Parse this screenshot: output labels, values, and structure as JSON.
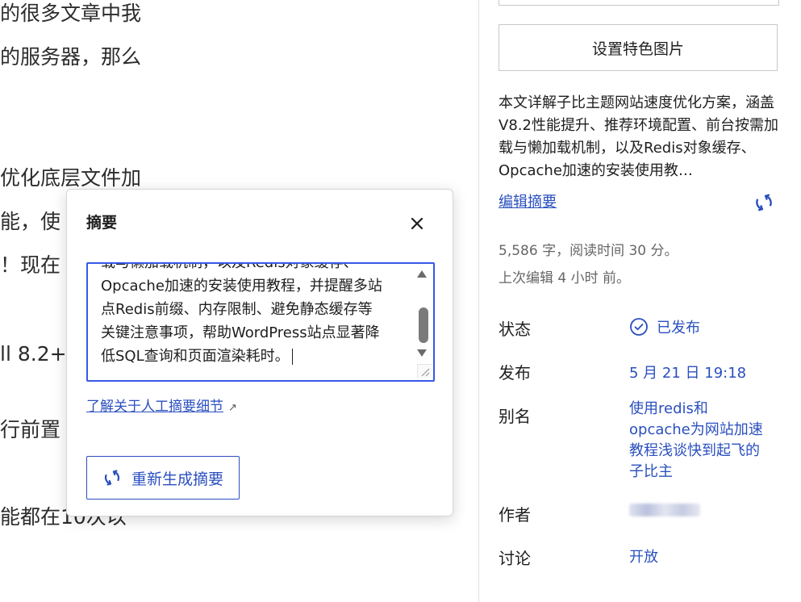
{
  "editor": {
    "lines": [
      "的很多文章中我",
      "的服务器，那么",
      "优化底层文件加",
      "能，使",
      "！现在",
      "ll 8.2+",
      "行前置",
      "能都在10次以"
    ]
  },
  "popover": {
    "title": "摘要",
    "textarea_value_partial_top": "载与懒加载机制，以及Redis对象缓存、",
    "textarea_lines": [
      "Opcache加速的安装使用教程，并提醒多站",
      "点Redis前缀、内存限制、避免静态缓存等",
      "关键注意事项，帮助WordPress站点显著降",
      "低SQL查询和页面渲染耗时。"
    ],
    "learn_link": "了解关于人工摘要细节",
    "regen_button": "重新生成摘要"
  },
  "sidebar": {
    "featured_image_button": "设置特色图片",
    "excerpt_preview": "本文详解子比主题网站速度优化方案，涵盖V8.2性能提升、推荐环境配置、前台按需加载与懒加载机制，以及Redis对象缓存、Opcache加速的安装使用教…",
    "edit_excerpt_link": "编辑摘要",
    "word_count": "5,586 字，阅读时间 30 分。",
    "last_edited": "上次编辑 4 小时 前。",
    "properties": {
      "status_label": "状态",
      "status_value": "已发布",
      "publish_label": "发布",
      "publish_value": "5 月 21 日 19:18",
      "slug_label": "别名",
      "slug_value": "使用redis和opcache为网站加速教程浅谈快到起飞的子比主",
      "author_label": "作者",
      "discussion_label": "讨论",
      "discussion_value": "开放"
    }
  },
  "colors": {
    "accent": "#2a4fbf",
    "focus": "#3858e9",
    "text": "#1e1e1e",
    "muted": "#666666"
  },
  "icons": [
    "close-icon",
    "regenerate-icon",
    "check-circle-icon",
    "external-arrow-icon"
  ]
}
